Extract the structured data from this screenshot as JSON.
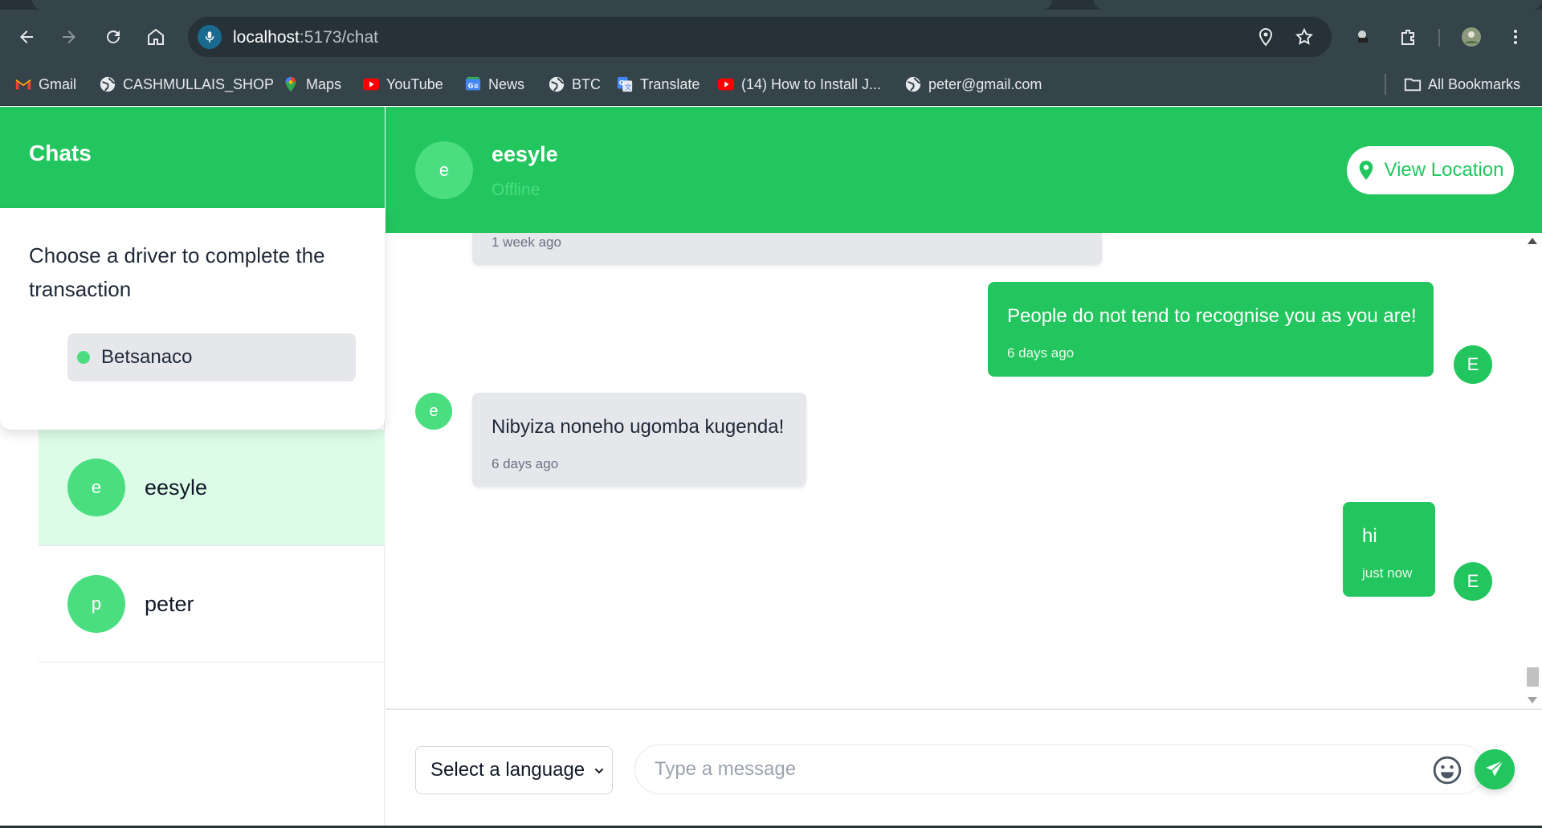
{
  "browser": {
    "url_host": "localhost",
    "url_path": ":5173/chat",
    "bookmarks": [
      {
        "label": "Gmail",
        "icon": "gmail-icon"
      },
      {
        "label": "CASHMULLAIS_SHOP",
        "icon": "globe-icon"
      },
      {
        "label": "Maps",
        "icon": "maps-icon"
      },
      {
        "label": "YouTube",
        "icon": "youtube-icon"
      },
      {
        "label": "News",
        "icon": "news-icon"
      },
      {
        "label": "BTC",
        "icon": "globe-icon"
      },
      {
        "label": "Translate",
        "icon": "translate-icon"
      },
      {
        "label": "(14) How to Install J...",
        "icon": "youtube-icon"
      },
      {
        "label": "peter@gmail.com",
        "icon": "globe-icon"
      }
    ],
    "all_bookmarks_label": "All Bookmarks"
  },
  "sidebar": {
    "title": "Chats",
    "driver_prompt": "Choose a driver to complete the transaction",
    "drivers": [
      {
        "name": "Betsanaco",
        "status_color": "#4ade80"
      }
    ],
    "contacts": [
      {
        "initial": "e",
        "name": "eesyle",
        "active": true
      },
      {
        "initial": "p",
        "name": "peter",
        "active": false
      }
    ]
  },
  "chat": {
    "contact_initial": "e",
    "contact_name": "eesyle",
    "contact_status": "Offline",
    "view_location_label": "View Location",
    "messages": [
      {
        "direction": "in",
        "text": "",
        "time": "1 week ago"
      },
      {
        "direction": "out",
        "text": "People do not tend to recognise you as you are!",
        "time": "6 days ago",
        "avatar": "E"
      },
      {
        "direction": "in",
        "text": "Nibyiza noneho ugomba kugenda!",
        "time": "6 days ago",
        "avatar": "e"
      },
      {
        "direction": "out",
        "text": "hi",
        "time": "just now",
        "avatar": "E"
      }
    ]
  },
  "composer": {
    "language_selected": "Select a language",
    "message_placeholder": "Type a message",
    "message_value": ""
  },
  "colors": {
    "accent": "#22c55e",
    "accent_light": "#4ade80",
    "active_contact_bg": "#dcfce7",
    "incoming_bubble": "#e5e7eb",
    "browser_chrome": "#35434a"
  }
}
